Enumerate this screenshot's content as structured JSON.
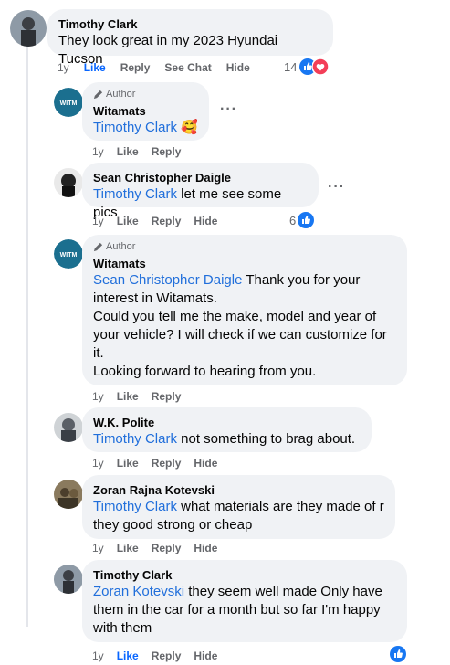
{
  "comments": [
    {
      "name": "Timothy Clark",
      "text": "They look great in my 2023 Hyundai Tucson",
      "time": "1y",
      "like": "Like",
      "reply": "Reply",
      "see_chat": "See Chat",
      "hide": "Hide",
      "reaction_count": "14",
      "liked": true
    },
    {
      "badge": "Author",
      "name": "Witamats",
      "mention": "Timothy Clark",
      "emoji": "🥰",
      "time": "1y",
      "like": "Like",
      "reply": "Reply"
    },
    {
      "name": "Sean Christopher Daigle",
      "mention": "Timothy Clark",
      "text": " let me see some pics",
      "time": "1y",
      "like": "Like",
      "reply": "Reply",
      "hide": "Hide",
      "reaction_count": "6"
    },
    {
      "badge": "Author",
      "name": "Witamats",
      "mention": "Sean Christopher Daigle",
      "text1": " Thank you for your interest in Witamats.",
      "text2": "Could you tell me the make, model and year of your vehicle? I will check if we can customize for it.",
      "text3": "Looking forward to hearing from you.",
      "time": "1y",
      "like": "Like",
      "reply": "Reply"
    },
    {
      "name": "W.K. Polite",
      "mention": "Timothy Clark",
      "text": " not something to brag about.",
      "time": "1y",
      "like": "Like",
      "reply": "Reply",
      "hide": "Hide"
    },
    {
      "name": "Zoran Rajna Kotevski",
      "mention": "Timothy Clark",
      "text": " what materials are they made of r they good strong or cheap",
      "time": "1y",
      "like": "Like",
      "reply": "Reply",
      "hide": "Hide"
    },
    {
      "name": "Timothy Clark",
      "mention": "Zoran Kotevski",
      "text": " they seem well made Only have them in the car for a month but so far I'm happy with them",
      "time": "1y",
      "like": "Like",
      "reply": "Reply",
      "hide": "Hide",
      "liked": true
    }
  ],
  "colors": {
    "bubble": "#f0f2f5",
    "mention": "#216fdb",
    "like_active": "#0866ff",
    "muted": "#65676b"
  },
  "icons": [
    "like-reaction-icon",
    "love-reaction-icon",
    "pencil-icon",
    "more-options-icon"
  ]
}
